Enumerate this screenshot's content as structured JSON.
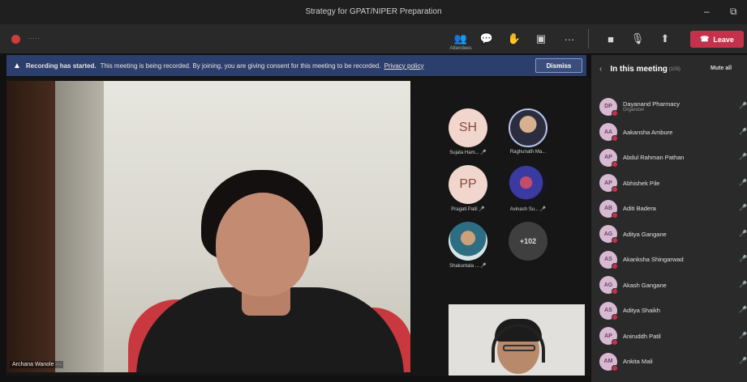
{
  "window": {
    "title": "Strategy for GPAT/NIPER Preparation",
    "minimize_glyph": "–",
    "restore_glyph": "⧉"
  },
  "toolbar": {
    "timer_text": "·····",
    "participants_glyph": "👥",
    "participants_caption": "Attendees",
    "chat_glyph": "💬",
    "reactions_glyph": "✋",
    "rooms_glyph": "▣",
    "more_glyph": "···",
    "camera_glyph": "■",
    "mic_glyph": "🎙",
    "share_glyph": "⬆",
    "leave_label": "Leave",
    "leave_glyph": "☎",
    "leave_color": "#c4314b"
  },
  "banner": {
    "heading": "Recording has started.",
    "message": "This meeting is being recorded. By joining, you are giving consent for this meeting to be recorded.",
    "link": "Privacy policy",
    "dismiss_label": "Dismiss",
    "warning_glyph": "▲",
    "background_color": "#2c3e6b"
  },
  "main_video": {
    "name": "Archana Wanole ···"
  },
  "tiles": [
    {
      "initials": "SH",
      "name": "Sujata Ham... 🎤"
    },
    {
      "initials": "",
      "name": "Raghunath Ma..."
    },
    {
      "initials": "PP",
      "name": "Pragati Patil 🎤"
    },
    {
      "initials": "",
      "name": "Avinash Su... 🎤"
    },
    {
      "initials": "",
      "name": "Shakuntala ... 🎤"
    },
    {
      "initials": "+102",
      "name": ""
    }
  ],
  "panel": {
    "title": "In this meeting",
    "count": "(105)",
    "mute_all_label": "Mute all",
    "back_glyph": "‹",
    "participants": [
      {
        "initials": "DP",
        "name": "Dayanand Pharmacy",
        "role": "Organizer"
      },
      {
        "initials": "AA",
        "name": "Aakansha Ambure",
        "role": ""
      },
      {
        "initials": "AP",
        "name": "Abdul Rahman Pathan",
        "role": ""
      },
      {
        "initials": "AP",
        "name": "Abhishek Pile",
        "role": ""
      },
      {
        "initials": "AB",
        "name": "Aditi Badera",
        "role": ""
      },
      {
        "initials": "AG",
        "name": "Aditya Gangane",
        "role": ""
      },
      {
        "initials": "AS",
        "name": "Akanksha Shingarwad",
        "role": ""
      },
      {
        "initials": "AG",
        "name": "Akash Gangane",
        "role": ""
      },
      {
        "initials": "AS",
        "name": "Aditya Shaikh",
        "role": ""
      },
      {
        "initials": "AP",
        "name": "Aniruddh Patil",
        "role": ""
      },
      {
        "initials": "AM",
        "name": "Ankita Mali",
        "role": ""
      }
    ],
    "mic_glyph": "🎤"
  }
}
